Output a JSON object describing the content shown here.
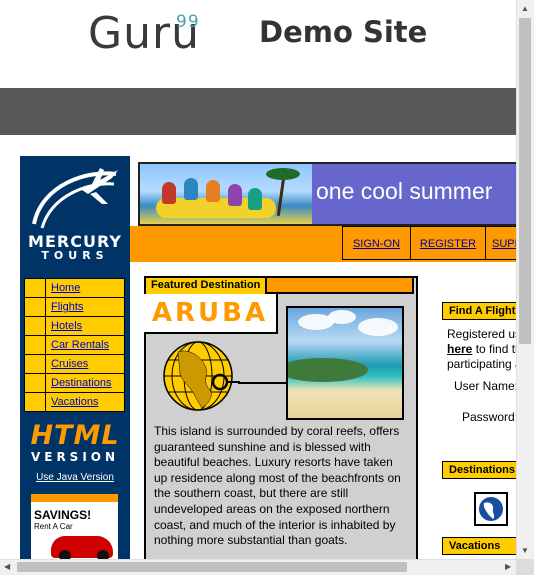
{
  "header": {
    "logo_text": "Guru",
    "logo_sup": "99",
    "site_title": "Demo Site"
  },
  "brand": {
    "line1": "MERCURY",
    "line2": "TOURS"
  },
  "banner": {
    "text": "one cool summer"
  },
  "top_menu": [
    {
      "label": "SIGN-ON"
    },
    {
      "label": "REGISTER"
    },
    {
      "label": "SUPPORT"
    }
  ],
  "nav": [
    {
      "label": "Home"
    },
    {
      "label": "Flights"
    },
    {
      "label": "Hotels"
    },
    {
      "label": "Car Rentals"
    },
    {
      "label": "Cruises"
    },
    {
      "label": "Destinations"
    },
    {
      "label": "Vacations"
    }
  ],
  "html_version": {
    "big": "HTML",
    "sub": "VERSION",
    "java_link": "Use Java Version"
  },
  "ad": {
    "title": "SAVINGS!",
    "subtitle": "Rent A Car"
  },
  "featured": {
    "label": "Featured Destination",
    "name": "ARUBA",
    "description": "This island is surrounded by coral reefs, offers guaranteed sunshine and is blessed with beautiful beaches. Luxury resorts have taken up residence along most of the beachfronts on the southern coast, but there are still undeveloped areas on the exposed northern coast, and much of the interior is inhabited by nothing more substantial than goats."
  },
  "find_flight": {
    "heading": "Find A Flight",
    "line1": "Registered users can",
    "line2_link": "here",
    "line2_rest": " to find the lowest",
    "line3": "participating airlines.",
    "user_label": "User Name:",
    "password_label": "Password:"
  },
  "destinations": {
    "heading": "Destinations"
  },
  "vacations": {
    "heading": "Vacations"
  },
  "colors": {
    "navy": "#003366",
    "orange": "#ff9900",
    "yellow": "#ffcc00",
    "link": "#0000cc"
  }
}
